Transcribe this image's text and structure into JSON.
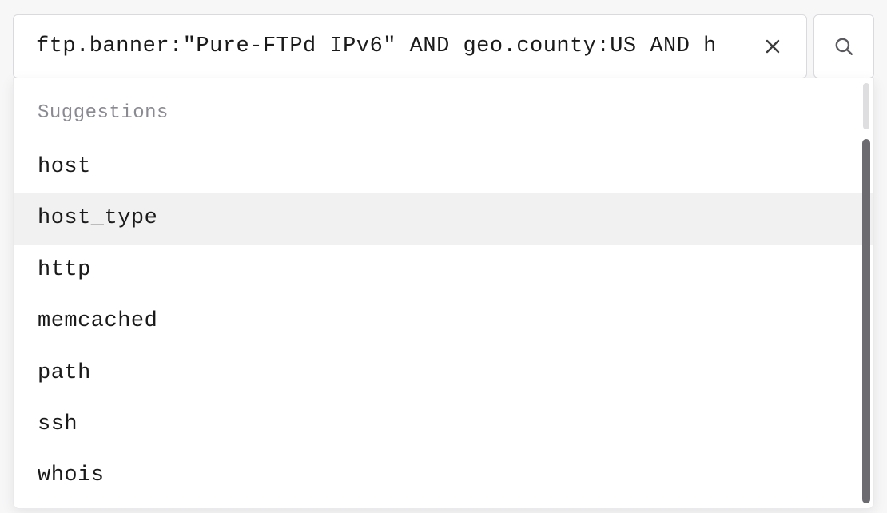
{
  "search": {
    "value": "ftp.banner:\"Pure-FTPd IPv6\" AND geo.county:US AND h",
    "placeholder": ""
  },
  "suggestions": {
    "header": "Suggestions",
    "items": [
      {
        "label": "host",
        "highlighted": false
      },
      {
        "label": "host_type",
        "highlighted": true
      },
      {
        "label": "http",
        "highlighted": false
      },
      {
        "label": "memcached",
        "highlighted": false
      },
      {
        "label": "path",
        "highlighted": false
      },
      {
        "label": "ssh",
        "highlighted": false
      },
      {
        "label": "whois",
        "highlighted": false
      }
    ]
  }
}
